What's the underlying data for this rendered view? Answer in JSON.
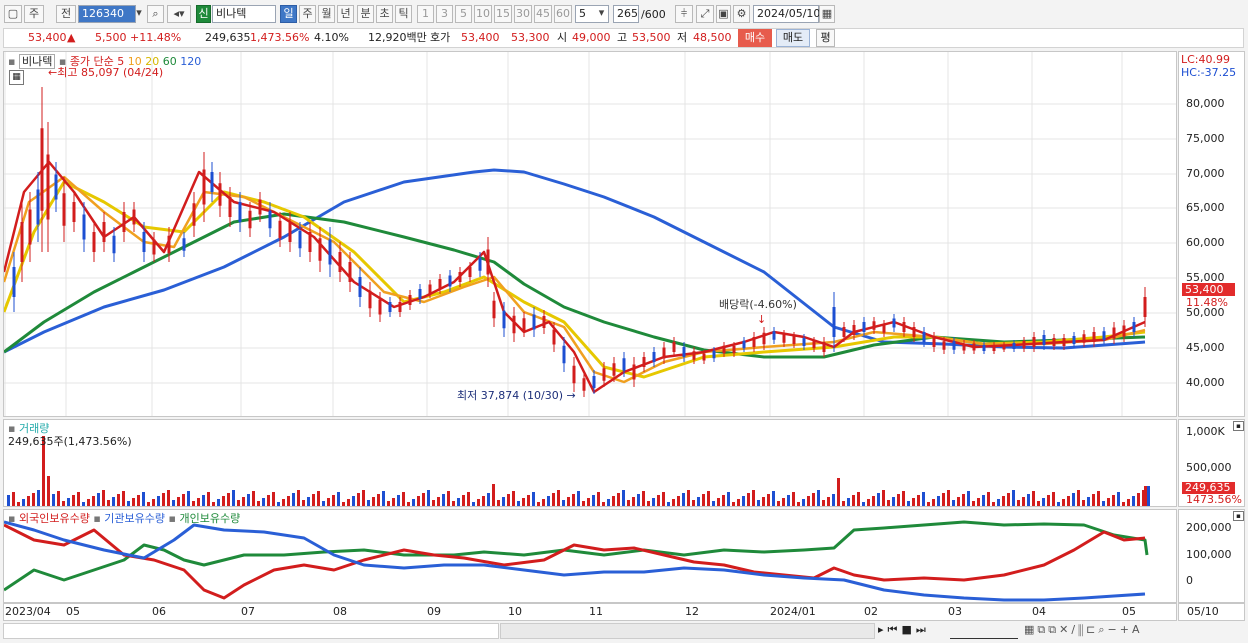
{
  "toolbar": {
    "period_selector": "주",
    "all_label": "전",
    "stock_code": "126340",
    "stock_badge": "신",
    "stock_name": "비나텍",
    "period_tabs": [
      "일",
      "주",
      "월",
      "년",
      "분",
      "초",
      "틱"
    ],
    "minute_options": [
      "1",
      "3",
      "5",
      "10",
      "15",
      "30",
      "45",
      "60"
    ],
    "count_value": "5",
    "data_count": "265",
    "data_max": "/600",
    "date": "2024/05/10"
  },
  "quote": {
    "price": "53,400",
    "change": "5,500",
    "change_pct": "+11.48%",
    "volume": "249,635",
    "volume_ratio": "1,473.56%",
    "turnover": "4.10%",
    "amount": "12,920백만",
    "hoga_label": "호가",
    "ask": "53,400",
    "bid": "53,300",
    "open_label": "시",
    "open": "49,000",
    "high_label": "고",
    "high": "53,500",
    "low_label": "저",
    "low": "48,500",
    "buy_button": "매수",
    "sell_button": "매도",
    "eval_button": "평"
  },
  "price_panel": {
    "title": "비나텍",
    "ma_label": "종가 단순",
    "ma_periods": [
      {
        "period": "5",
        "color": "#d21d1d"
      },
      {
        "period": "10",
        "color": "#f0a020"
      },
      {
        "period": "20",
        "color": "#e6c800"
      },
      {
        "period": "60",
        "color": "#1f8a3a"
      },
      {
        "period": "120",
        "color": "#2a5fd6"
      }
    ],
    "high_note": "최고 85,097 (04/24)",
    "low_note": "최저 37,874 (10/30)",
    "dividend_note": "배당락(-4.60%)",
    "lc": "LC:40.99",
    "hc": "HC:-37.25",
    "price_tag": "53,400",
    "pct_tag": "11.48%",
    "y_ticks": [
      "80,000",
      "75,000",
      "70,000",
      "65,000",
      "60,000",
      "55,000",
      "50,000",
      "45,000",
      "40,000"
    ]
  },
  "volume_panel": {
    "title": "거래량",
    "subtitle": "249,635주(1,473.56%)",
    "y_ticks": [
      "1,000K",
      "500,000"
    ],
    "value_tag": "249,635",
    "pct_tag": "1473.56%"
  },
  "holding_panel": {
    "legend": [
      {
        "name": "외국인보유수량",
        "color": "#d21d1d"
      },
      {
        "name": "기관보유수량",
        "color": "#2a5fd6"
      },
      {
        "name": "개인보유수량",
        "color": "#1f8a3a"
      }
    ],
    "y_ticks": [
      "200,000",
      "100,000",
      "0"
    ]
  },
  "x_axis": {
    "labels": [
      "2023/04",
      "05",
      "06",
      "07",
      "08",
      "09",
      "10",
      "11",
      "12",
      "2024/01",
      "02",
      "03",
      "04",
      "05"
    ],
    "end_label": "05/10"
  },
  "colors": {
    "up": "#d21d1d",
    "down": "#1d4fd2",
    "accent": "#3f77c6"
  }
}
